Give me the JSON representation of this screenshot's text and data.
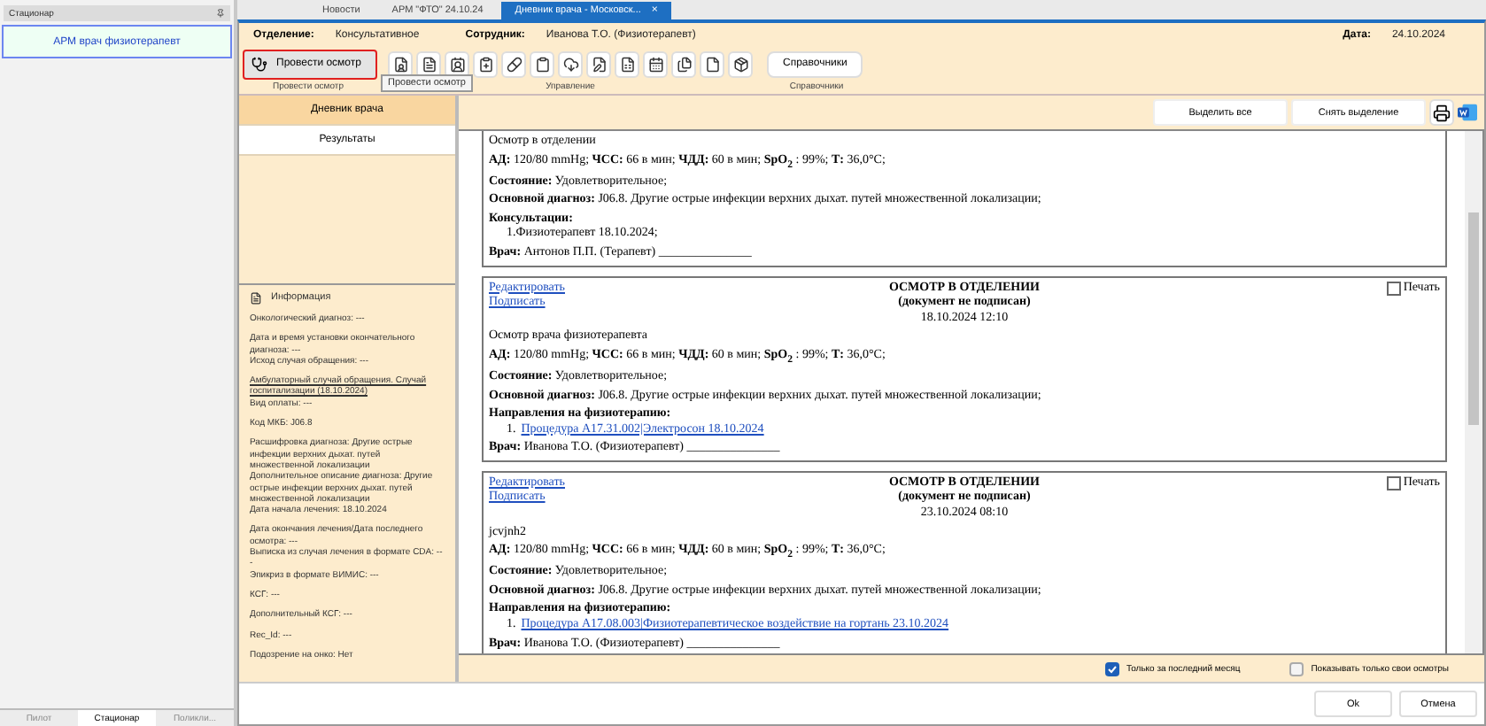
{
  "side_panel": {
    "title": "Стационар",
    "items": [
      {
        "label": "АРМ врач физиотерапевт",
        "selected": true
      }
    ],
    "bottom_tabs": [
      {
        "label": "Пилот",
        "selected": false
      },
      {
        "label": "Стационар",
        "selected": true
      },
      {
        "label": "Поликли...",
        "selected": false
      }
    ]
  },
  "tabs": [
    {
      "label": "Новости",
      "selected": false
    },
    {
      "label": "АРМ \"ФТО\" 24.10.24",
      "selected": false
    },
    {
      "label": "Дневник врача - Московск...",
      "selected": true
    }
  ],
  "close_glyph": "×",
  "header": {
    "fields": [
      {
        "label": "Отделение:",
        "value": "Консультативное"
      },
      {
        "label": "Сотрудник:",
        "value": "Иванова Т.О. (Физиотерапевт)"
      }
    ],
    "date_label": "Дата:",
    "date": "24.10.2024"
  },
  "toolbar": {
    "main_button": {
      "label": "Провести осмотр",
      "highlighted": true
    },
    "tooltip": "Провести осмотр",
    "groups": [
      {
        "label": "Провести осмотр"
      },
      {
        "label": "Управление"
      },
      {
        "label": "Справочники"
      }
    ],
    "reference_button": "Справочники"
  },
  "nav": [
    {
      "label": "Дневник врача",
      "selected": true
    },
    {
      "label": "Результаты",
      "selected": false
    }
  ],
  "info": {
    "title": "Информация",
    "blocks": [
      [
        "Онкологический диагноз: ---"
      ],
      [
        "Дата и время установки окончательного диагноза: ---",
        "Исход случая обращения: ---"
      ],
      [
        {
          "link": "Амбулаторный случай обращения. Случай госпитализации (18.10.2024)"
        },
        "Вид оплаты: ---"
      ],
      [
        "Код МКБ: J06.8"
      ],
      [
        "Расшифровка диагноза: Другие острые инфекции верхних дыхат. путей множественной локализации",
        "Дополнительное описание диагноза: Другие острые инфекции верхних дыхат. путей множественной локализации",
        "Дата начала лечения: 18.10.2024"
      ],
      [
        "Дата окончания лечения/Дата последнего осмотра: ---",
        "Выписка из случая лечения в формате CDA: ---",
        "Эпикриз в формате ВИМИС: ---"
      ],
      [
        "КСГ: ---"
      ],
      [
        "Дополнительный КСГ: ---"
      ],
      [
        "Rec_Id: ---"
      ],
      [
        "Подозрение на онко: Нет"
      ]
    ]
  },
  "doc_toolbar": {
    "buttons": [
      "Выделить все",
      "Снять выделение"
    ]
  },
  "records": [
    {
      "note": "Осмотр в отделении",
      "lines": [
        "**АД:** 120/80 mmHg; **ЧСС:** 66 в мин; **ЧДД:** 60 в мин; **SpO$_{2}$** : 99%; **Т:** 36,0°C;",
        "**Состояние:** Удовлетворительное;"
      ],
      "diagnosis": "**Основной диагноз:** J06.8. Другие острые инфекции верхних дыхат. путей множественной локализации;",
      "section": "Консультации:",
      "items": [
        {
          "text": "1.Физиотерапевт 18.10.2024;",
          "kind": "plain"
        }
      ],
      "doctor": "**Врач:** Антонов П.П. (Терапевт) _______________"
    },
    {
      "header": {
        "title": "ОСМОТР В ОТДЕЛЕНИИ",
        "subtitle": "(документ не подписан)",
        "datetime": "18.10.2024 12:10",
        "edit": "Редактировать",
        "sign": "Подписать",
        "print": "Печать",
        "print_checked": false
      },
      "note": "Осмотр врача физиотерапевта",
      "lines": [
        "**АД:** 120/80 mmHg; **ЧСС:** 66 в мин; **ЧДД:** 60 в мин; **SpO$_{2}$** : 99%; **Т:** 36,0°C;",
        "**Состояние:** Удовлетворительное;"
      ],
      "diagnosis": "**Основной диагноз:** J06.8. Другие острые инфекции верхних дыхат. путей множественной локализации;",
      "section": "Направления на физиотерапию:",
      "items": [
        {
          "text": "Процедура A17.31.002|Электросон 18.10.2024",
          "kind": "link",
          "number": "1."
        }
      ],
      "doctor": "**Врач:** Иванова Т.О. (Физиотерапевт) _______________"
    },
    {
      "header": {
        "title": "ОСМОТР В ОТДЕЛЕНИИ",
        "subtitle": "(документ не подписан)",
        "datetime": "23.10.2024 08:10",
        "edit": "Редактировать",
        "sign": "Подписать",
        "print": "Печать",
        "print_checked": false
      },
      "note": "jcvjnh2",
      "lines": [
        "**АД:** 120/80 mmHg; **ЧСС:** 66 в мин; **ЧДД:** 60 в мин; **SpO$_{2}$** : 99%; **Т:** 36,0°C;",
        "**Состояние:** Удовлетворительное;"
      ],
      "diagnosis": "**Основной диагноз:** J06.8. Другие острые инфекции верхних дыхат. путей множественной локализации;",
      "section": "Направления на физиотерапию:",
      "items": [
        {
          "text": "Процедура A17.08.003|Физиотерапевтическое воздействие на гортань 23.10.2024",
          "kind": "link",
          "number": "1."
        }
      ],
      "doctor": "**Врач:** Иванова Т.О. (Физиотерапевт) _______________"
    }
  ],
  "filters": [
    {
      "label": "Только за последний месяц",
      "checked": true
    },
    {
      "label": "Показывать только свои осмотры",
      "checked": false
    }
  ],
  "footer_buttons": [
    "Ok",
    "Отмена"
  ]
}
